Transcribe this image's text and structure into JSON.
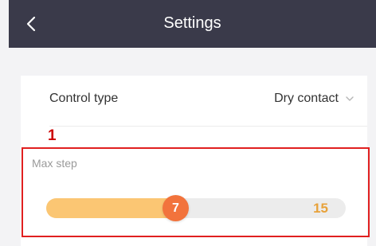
{
  "header": {
    "title": "Settings",
    "back_icon": "chevron-left-icon"
  },
  "control_type": {
    "label": "Control type",
    "value": "Dry contact",
    "dropdown_icon": "chevron-down-icon"
  },
  "annotation": {
    "number": "1",
    "color": "#e02020"
  },
  "max_step": {
    "label": "Max step",
    "value": "7",
    "max": "15",
    "value_number": 7,
    "max_number": 15
  },
  "colors": {
    "header_bg": "#3a3a4a",
    "slider_fill": "#fbc673",
    "slider_thumb": "#f2733c",
    "max_text": "#e8a23a"
  }
}
